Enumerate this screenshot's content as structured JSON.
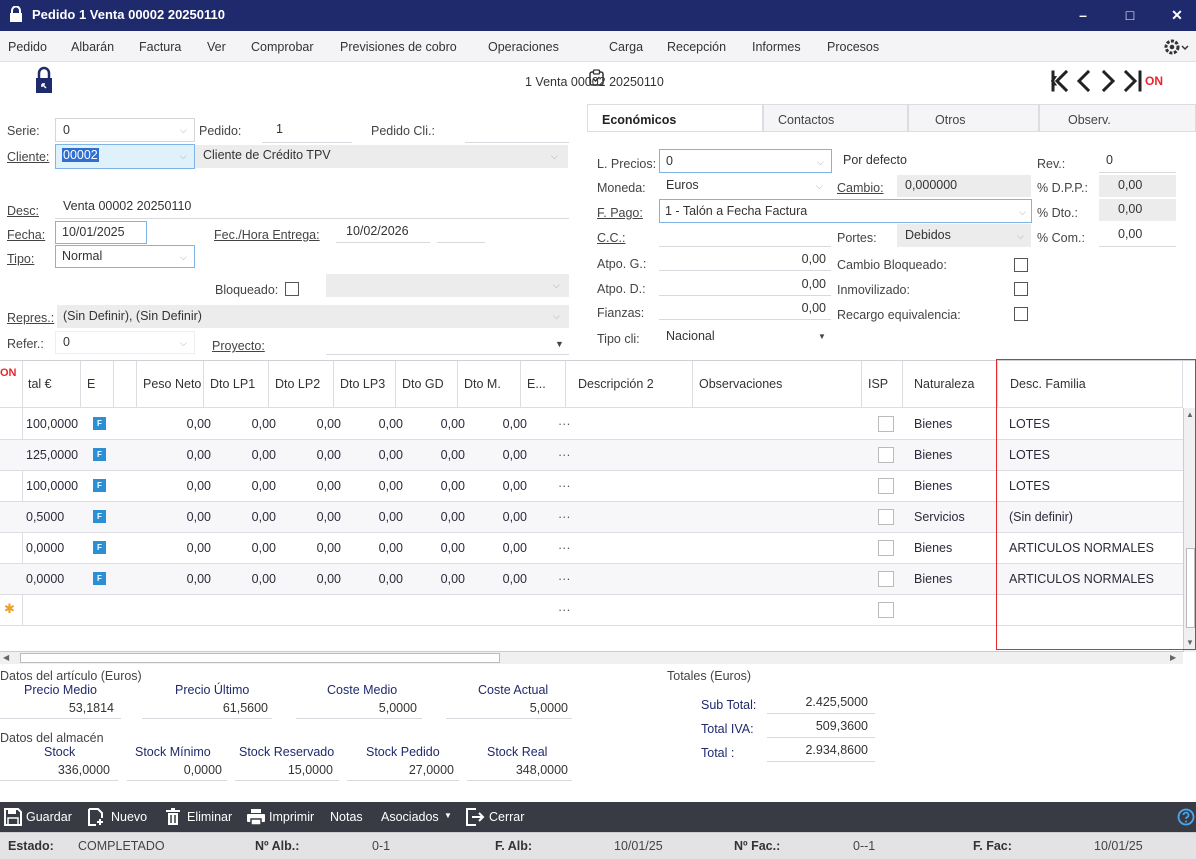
{
  "window": {
    "title": "Pedido 1 Venta 00002 20250110"
  },
  "menu": [
    "Pedido",
    "Albarán",
    "Factura",
    "Ver",
    "Comprobar",
    "Previsiones de cobro",
    "Operaciones",
    "Carga",
    "Recepción",
    "Informes",
    "Procesos"
  ],
  "record_title": "1 Venta 00002 20250110",
  "nav": {
    "on": "ON"
  },
  "header": {
    "serie_label": "Serie:",
    "serie": "0",
    "pedido_label": "Pedido:",
    "pedido": "1",
    "pedido_cli_label": "Pedido Cli.:",
    "cliente_label": "Cliente:",
    "cliente": "00002",
    "cliente_name": "Cliente de Crédito TPV",
    "desc_label": "Desc:",
    "desc": "Venta 00002 20250110",
    "fecha_label": "Fecha:",
    "fecha": "10/01/2025",
    "entrega_label": "Fec./Hora Entrega:",
    "entrega": "10/02/2026",
    "tipo_label": "Tipo:",
    "tipo": "Normal",
    "bloqueado_label": "Bloqueado:",
    "repres_label": "Repres.:",
    "repres": "(Sin Definir), (Sin Definir)",
    "refer_label": "Refer.:",
    "refer": "0",
    "proyecto_label": "Proyecto:"
  },
  "tabs": [
    "Económicos",
    "Contactos",
    "Otros",
    "Observ."
  ],
  "economicos": {
    "precios_label": "L. Precios:",
    "precios": "0",
    "por_defecto": "Por defecto",
    "rev_label": "Rev.:",
    "rev": "0",
    "moneda_label": "Moneda:",
    "moneda": "Euros",
    "cambio_label": "Cambio:",
    "cambio": "0,000000",
    "dpp_label": "% D.P.P.:",
    "dpp": "0,00",
    "fpago_label": "F. Pago:",
    "fpago": "1 - Talón a Fecha Factura",
    "dto_label": "% Dto.:",
    "dto": "0,00",
    "cc_label": "C.C.:",
    "portes_label": "Portes:",
    "portes": "Debidos",
    "com_label": "% Com.:",
    "com": "0,00",
    "atpog_label": "Atpo. G.:",
    "atpog": "0,00",
    "cambio_bloq_label": "Cambio Bloqueado:",
    "atpod_label": "Atpo. D.:",
    "atpod": "0,00",
    "inmov_label": "Inmovilizado:",
    "fianzas_label": "Fianzas:",
    "fianzas": "0,00",
    "recargo_label": "Recargo equivalencia:",
    "tipocli_label": "Tipo cli:",
    "tipocli": "Nacional"
  },
  "grid": {
    "corner": "ON",
    "headers": [
      "tal €",
      "E",
      "",
      "Peso Neto",
      "Dto LP1",
      "Dto LP2",
      "Dto LP3",
      "Dto GD",
      "Dto M.",
      "E...",
      "Descripción 2",
      "Observaciones",
      "ISP",
      "Naturaleza",
      "Desc. Familia"
    ],
    "rows": [
      {
        "total": "100,0000",
        "e": "F",
        "dto": [
          "0,00",
          "0,00",
          "0,00",
          "0,00",
          "0,00",
          "0,00"
        ],
        "more": "···",
        "nat": "Bienes",
        "fam": "LOTES"
      },
      {
        "total": "125,0000",
        "e": "F",
        "dto": [
          "0,00",
          "0,00",
          "0,00",
          "0,00",
          "0,00",
          "0,00"
        ],
        "more": "···",
        "nat": "Bienes",
        "fam": "LOTES"
      },
      {
        "total": "100,0000",
        "e": "F",
        "dto": [
          "0,00",
          "0,00",
          "0,00",
          "0,00",
          "0,00",
          "0,00"
        ],
        "more": "···",
        "nat": "Bienes",
        "fam": "LOTES"
      },
      {
        "total": "0,5000",
        "e": "F",
        "dto": [
          "0,00",
          "0,00",
          "0,00",
          "0,00",
          "0,00",
          "0,00"
        ],
        "more": "···",
        "nat": "Servicios",
        "fam": "(Sin definir)"
      },
      {
        "total": "0,0000",
        "e": "F",
        "dto": [
          "0,00",
          "0,00",
          "0,00",
          "0,00",
          "0,00",
          "0,00"
        ],
        "more": "···",
        "nat": "Bienes",
        "fam": "ARTICULOS NORMALES"
      },
      {
        "total": "0,0000",
        "e": "F",
        "dto": [
          "0,00",
          "0,00",
          "0,00",
          "0,00",
          "0,00",
          "0,00"
        ],
        "more": "···",
        "nat": "Bienes",
        "fam": "ARTICULOS NORMALES"
      }
    ],
    "new_row_more": "···",
    "highlight_color": "#e8262d"
  },
  "articulo": {
    "title": "Datos del artículo (Euros)",
    "precio_medio_label": "Precio Medio",
    "precio_medio": "53,1814",
    "precio_ultimo_label": "Precio Último",
    "precio_ultimo": "61,5600",
    "coste_medio_label": "Coste Medio",
    "coste_medio": "5,0000",
    "coste_actual_label": "Coste Actual",
    "coste_actual": "5,0000"
  },
  "almacen": {
    "title": "Datos del almacén",
    "stock_label": "Stock",
    "stock": "336,0000",
    "minimo_label": "Stock Mínimo",
    "minimo": "0,0000",
    "reservado_label": "Stock Reservado",
    "reservado": "15,0000",
    "pedido_label": "Stock Pedido",
    "pedido": "27,0000",
    "real_label": "Stock Real",
    "real": "348,0000"
  },
  "totales": {
    "title": "Totales (Euros)",
    "subtotal_label": "Sub Total:",
    "subtotal": "2.425,5000",
    "iva_label": "Total IVA:",
    "iva": "509,3600",
    "total_label": "Total :",
    "total": "2.934,8600"
  },
  "toolbar": {
    "guardar": "Guardar",
    "nuevo": "Nuevo",
    "eliminar": "Eliminar",
    "imprimir": "Imprimir",
    "notas": "Notas",
    "asociados": "Asociados",
    "cerrar": "Cerrar"
  },
  "status": {
    "estado_label": "Estado:",
    "estado": "COMPLETADO",
    "nalb_label": "Nº Alb.:",
    "nalb": "0-1",
    "falb_label": "F. Alb:",
    "falb": "10/01/25",
    "nfac_label": "Nº Fac.:",
    "nfac": "0--1",
    "ffac_label": "F. Fac:",
    "ffac": "10/01/25"
  }
}
